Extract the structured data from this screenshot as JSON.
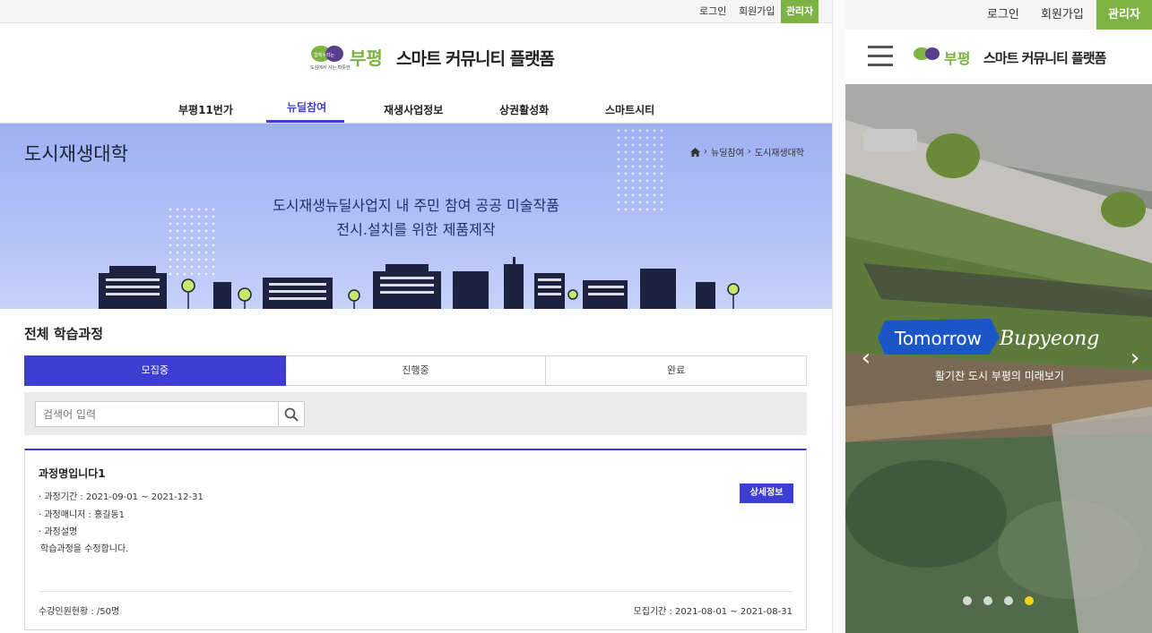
{
  "desktop": {
    "util": {
      "login": "로그인",
      "signup": "회원가입",
      "admin": "관리자"
    },
    "brand": {
      "name": "스마트 커뮤니티 플랫폼",
      "logo_word": "부평",
      "logo_small_1": "함께누리는",
      "logo_small_2": "도심에서 사는 따뜻한"
    },
    "nav": [
      {
        "label": "부평11번가"
      },
      {
        "label": "뉴딜참여"
      },
      {
        "label": "재생사업정보"
      },
      {
        "label": "상권활성화"
      },
      {
        "label": "스마트시티"
      }
    ],
    "banner": {
      "title": "도시재생대학",
      "breadcrumb": [
        "뉴딜참여",
        "도시재생대학"
      ],
      "line1": "도시재생뉴딜사업지 내 주민 참여 공공 미술작품",
      "line2": "전시.설치를 위한 제품제작"
    },
    "section_title": "전체 학습과정",
    "tabs": [
      {
        "label": "모집중"
      },
      {
        "label": "진행중"
      },
      {
        "label": "완료"
      }
    ],
    "search": {
      "placeholder": "검색어 입력"
    },
    "course": {
      "name": "과정명입니다1",
      "period": "· 과정기간 : 2021-09-01 ~ 2021-12-31",
      "manager": "· 과정매니저 : 홍길동1",
      "desc_label": "· 과정설명",
      "desc": "학습과정을 수정합니다.",
      "detail_button": "상세정보",
      "enrolled": "수강인원현황 : /50명",
      "recruit_period": "모집기간 : 2021-08-01 ~ 2021-08-31"
    }
  },
  "mobile": {
    "util": {
      "login": "로그인",
      "signup": "회원가입",
      "admin": "관리자"
    },
    "brand": {
      "name": "스마트 커뮤니티 플랫폼",
      "logo_word": "부평"
    },
    "hero": {
      "tomorrow": "Tomorrow",
      "bupyeong": "Bupyeong",
      "sub": "활기찬 도시 부평의 미래보기"
    },
    "slide_count": 4,
    "active_slide": 4
  },
  "colors": {
    "accent": "#3d3dd4",
    "admin_green": "#7cb342",
    "banner_blue": "#a8b8f4",
    "active_dot": "#f2d21b"
  },
  "icons": [
    "home-icon",
    "chevron-right-icon",
    "search-icon",
    "hamburger-icon",
    "arrow-left-icon",
    "arrow-right-icon"
  ]
}
